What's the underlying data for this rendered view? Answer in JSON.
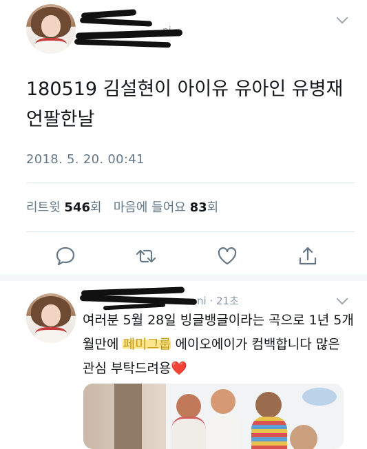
{
  "main_tweet": {
    "handle_meta": "ni",
    "text": "180519 김설현이 아이유 유아인 유병재 언팔한날",
    "date": "2018. 5. 20. 00:41",
    "stats": {
      "retweets_label": "리트윗",
      "retweets_count": "546",
      "retweets_unit": "회",
      "likes_label": "마음에 들어요",
      "likes_count": "83",
      "likes_unit": "회"
    }
  },
  "reply_tweet": {
    "meta": "ni · 21초",
    "text_before": "여러분 5월 28일 빙글뱅글이라는 곡으로 1년 5개월만에 ",
    "highlight": "페미그룹",
    "text_after": " 에이오에이가 컴백합니다 많은 관심 부탁드려용",
    "emoji": "❤️"
  },
  "icons": [
    "reply-icon",
    "retweet-icon",
    "like-icon",
    "share-icon",
    "chevron-down-icon"
  ],
  "colors": {
    "secondary_text": "#657786",
    "divider": "#e1e8ed",
    "highlight": "#fbe58d"
  }
}
